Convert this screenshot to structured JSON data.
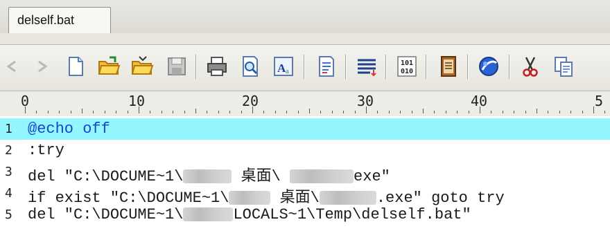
{
  "tab": {
    "label": "delself.bat"
  },
  "toolbar": {
    "buttons": [
      {
        "name": "back-arrow-icon"
      },
      {
        "name": "forward-arrow-icon"
      },
      {
        "name": "new-file-icon"
      },
      {
        "name": "open-folder-icon"
      },
      {
        "name": "open-folder-alt-icon"
      },
      {
        "name": "save-icon"
      },
      {
        "name": "print-icon"
      },
      {
        "name": "print-preview-icon"
      },
      {
        "name": "font-icon"
      },
      {
        "name": "document-icon"
      },
      {
        "name": "word-wrap-icon"
      },
      {
        "name": "binary-icon"
      },
      {
        "name": "book-icon"
      },
      {
        "name": "web-globe-icon"
      },
      {
        "name": "cut-icon"
      },
      {
        "name": "copy-icon"
      }
    ]
  },
  "ruler": {
    "labels": [
      "0",
      "10",
      "20",
      "30",
      "40",
      "5"
    ]
  },
  "editor": {
    "line_numbers": [
      "1",
      "2",
      "3",
      "4",
      "5"
    ],
    "lines": [
      {
        "text": "@echo off"
      },
      {
        "text": ":try"
      },
      {
        "p1": "del \"C:\\DOCUME~1\\",
        "p2": "桌面\\",
        "p3": "exe\""
      },
      {
        "p1": "if exist \"C:\\DOCUME~1\\",
        "p2": "桌面\\",
        "p3": ".exe\" goto try"
      },
      {
        "p1": "del \"C:\\DOCUME~1\\",
        "p2": "LOCALS~1\\Temp\\delself.bat\""
      }
    ]
  },
  "colors": {
    "highlight": "#94f6ff",
    "keyword": "#1548c8"
  }
}
